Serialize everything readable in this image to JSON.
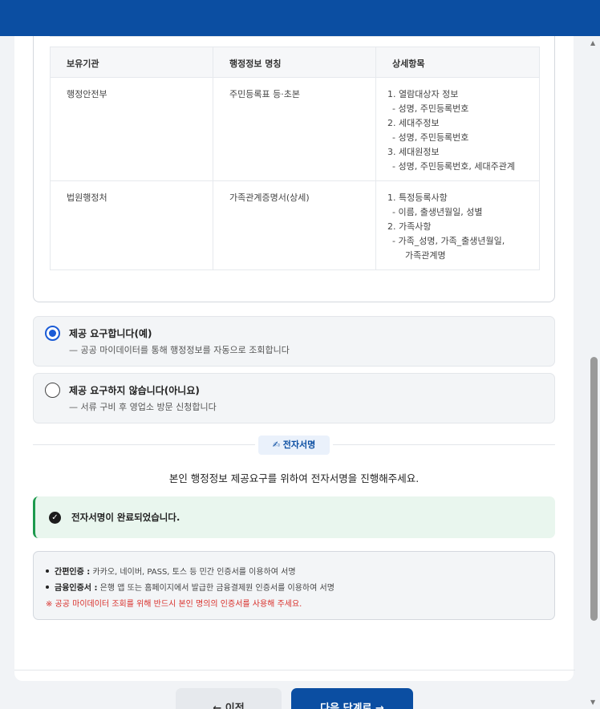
{
  "table": {
    "headers": [
      "보유기관",
      "행정정보 명칭",
      "상세항목"
    ],
    "rows": [
      {
        "org": "행정안전부",
        "name": "주민등록표 등·초본",
        "details": [
          {
            "text": "1. 열람대상자 정보",
            "level": 0
          },
          {
            "text": "- 성명, 주민등록번호",
            "level": 1
          },
          {
            "text": "2. 세대주정보",
            "level": 0
          },
          {
            "text": "- 성명, 주민등록번호",
            "level": 1
          },
          {
            "text": "3. 세대원정보",
            "level": 0
          },
          {
            "text": "- 성명, 주민등록번호, 세대주관계",
            "level": 1
          }
        ]
      },
      {
        "org": "법원행정처",
        "name": "가족관계증명서(상세)",
        "details": [
          {
            "text": "1. 특정등록사항",
            "level": 0
          },
          {
            "text": "- 이름, 출생년월일, 성별",
            "level": 1
          },
          {
            "text": "2. 가족사항",
            "level": 0
          },
          {
            "text": "- 가족_성명, 가족_출생년월일,",
            "level": 1
          },
          {
            "text": "가족관계명",
            "level": 2
          }
        ]
      }
    ]
  },
  "options": [
    {
      "title": "제공 요구합니다(예)",
      "desc": "— 공공 마이데이터를 통해 행정정보를 자동으로 조회합니다",
      "checked": true
    },
    {
      "title": "제공 요구하지 않습니다(아니요)",
      "desc": "— 서류 구비 후 영업소 방문 신청합니다",
      "checked": false
    }
  ],
  "signature": {
    "chip_label": "✍ 전자서명",
    "message": "본인 행정정보 제공요구를 위하여 전자서명을 진행해주세요.",
    "success": "전자서명이 완료되었습니다."
  },
  "notice": {
    "items": [
      {
        "label": "간편인증 :",
        "text": " 카카오, 네이버, PASS, 토스 등 민간 인증서를 이용하여 서명"
      },
      {
        "label": "금융인증서 :",
        "text": " 은행 앱 또는 홈페이지에서 발급한 금융결제원 인증서를 이용하여 서명"
      }
    ],
    "warning": "※ 공공 마이데이터 조회를 위해 반드시 본인 명의의 인증서를 사용해 주세요."
  },
  "buttons": {
    "prev": "← 이전",
    "next": "다음 단계로 →"
  },
  "colors": {
    "brand": "#0b4ea2",
    "success": "#1e9a4e",
    "warning": "#d9302b"
  }
}
